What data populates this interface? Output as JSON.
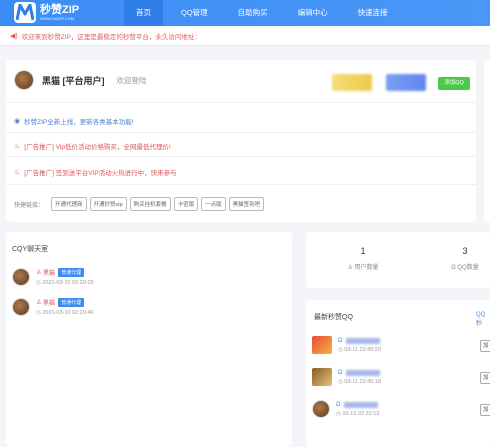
{
  "brand": {
    "title": "秒赞ZIP",
    "subtitle": "WWW.MZZIP.COM"
  },
  "nav": [
    "首页",
    "QQ管理",
    "自助购买",
    "编辑中心",
    "快速连接"
  ],
  "notice": "欢迎来到秒赞ZIP，这里是最稳定的秒赞平台，永久访问地址：",
  "user": {
    "name": "黑猫 [平台用户]",
    "welcome": "欢迎登陆",
    "add_qq": "添加QQ"
  },
  "announcements": [
    {
      "text": "秒赞ZIP全新上线，更新各类基本功能!",
      "tone": "blue"
    },
    {
      "text": "[广告推广] Vip低价活动价格购买，全网最低代理价!",
      "tone": "red"
    },
    {
      "text": "[广告推广] 签到送平台VIP活动火热进行中，快来参与",
      "tone": "red"
    }
  ],
  "quick_links": {
    "label": "快捷链接：",
    "items": [
      "开通代理商",
      "开通秒赞vip",
      "购买挂机套餐",
      "卡密版",
      "一点版",
      "黑猫签到吧"
    ]
  },
  "chat": {
    "title": "CQY聊天室",
    "messages": [
      {
        "name": "黑猫",
        "badge": "普通代理",
        "time": "2021-03-10 02:20:29"
      },
      {
        "name": "黑猫",
        "badge": "普通代理",
        "time": "2021-03-10 02:20:46"
      }
    ]
  },
  "stats": [
    {
      "value": "1",
      "label": "用户数量"
    },
    {
      "value": "3",
      "label": "QQ数量"
    }
  ],
  "latest": {
    "title": "最新秒赞QQ",
    "more": "QQ秒",
    "items": [
      {
        "time": "03-11 22:45:20",
        "button": "加"
      },
      {
        "time": "03-11 22:45:18",
        "button": "加"
      },
      {
        "time": "03-10 02:22:13",
        "button": "加"
      }
    ]
  },
  "colors": {
    "primary": "#3b8cf5",
    "accent_red": "#e05656",
    "success": "#4bc94b"
  }
}
